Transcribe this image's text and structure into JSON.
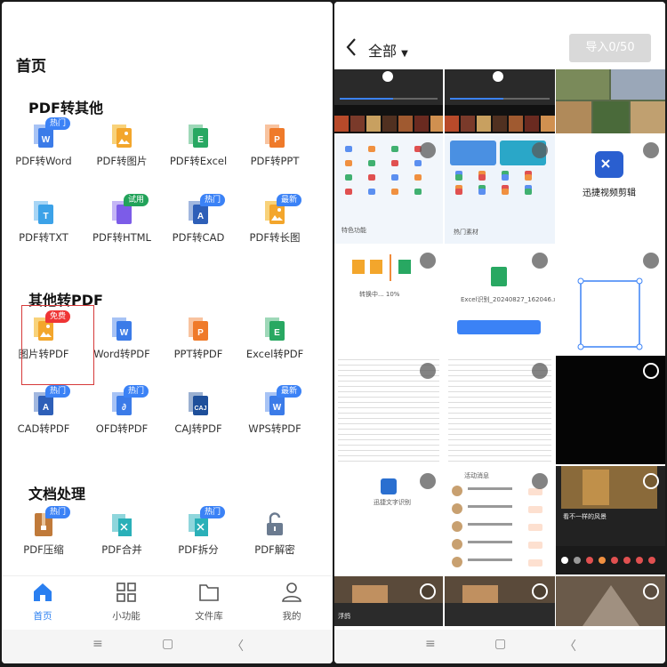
{
  "left": {
    "title": "首页",
    "sections": [
      {
        "title": "PDF转其他",
        "items": [
          {
            "label": "PDF转Word",
            "badge": "热门",
            "badge_color": "blue",
            "icon": "word-doc-icon",
            "color": "#3b7be8"
          },
          {
            "label": "PDF转图片",
            "badge": "",
            "icon": "image-doc-icon",
            "color": "#f3a62c"
          },
          {
            "label": "PDF转Excel",
            "badge": "",
            "icon": "excel-doc-icon",
            "color": "#28a862"
          },
          {
            "label": "PDF转PPT",
            "badge": "",
            "icon": "ppt-doc-icon",
            "color": "#ef7a2a"
          },
          {
            "label": "PDF转TXT",
            "badge": "",
            "icon": "txt-doc-icon",
            "color": "#3ca2e8"
          },
          {
            "label": "PDF转HTML",
            "badge": "试用",
            "badge_color": "green",
            "icon": "html-doc-icon",
            "color": "#7c5ce8"
          },
          {
            "label": "PDF转CAD",
            "badge": "热门",
            "badge_color": "blue",
            "icon": "cad-doc-icon",
            "color": "#2e5fb8"
          },
          {
            "label": "PDF转长图",
            "badge": "最新",
            "badge_color": "blue",
            "icon": "long-image-icon",
            "color": "#f3a62c"
          }
        ]
      },
      {
        "title": "其他转PDF",
        "items": [
          {
            "label": "图片转PDF",
            "badge": "免费",
            "badge_color": "red",
            "icon": "image-to-pdf-icon",
            "color": "#f3a62c",
            "selected": true
          },
          {
            "label": "Word转PDF",
            "badge": "",
            "icon": "word-to-pdf-icon",
            "color": "#3b7be8"
          },
          {
            "label": "PPT转PDF",
            "badge": "",
            "icon": "ppt-to-pdf-icon",
            "color": "#ef7a2a"
          },
          {
            "label": "Excel转PDF",
            "badge": "",
            "icon": "excel-to-pdf-icon",
            "color": "#28a862"
          },
          {
            "label": "CAD转PDF",
            "badge": "热门",
            "badge_color": "blue",
            "icon": "cad-to-pdf-icon",
            "color": "#2e5fb8"
          },
          {
            "label": "OFD转PDF",
            "badge": "热门",
            "badge_color": "blue",
            "icon": "ofd-to-pdf-icon",
            "color": "#3b7be8"
          },
          {
            "label": "CAJ转PDF",
            "badge": "",
            "icon": "caj-to-pdf-icon",
            "color": "#1e4f9a"
          },
          {
            "label": "WPS转PDF",
            "badge": "最新",
            "badge_color": "blue",
            "icon": "wps-to-pdf-icon",
            "color": "#3b7be8"
          }
        ]
      },
      {
        "title": "文档处理",
        "items": [
          {
            "label": "PDF压缩",
            "badge": "热门",
            "badge_color": "blue",
            "icon": "zip-icon",
            "color": "#c07a3a"
          },
          {
            "label": "PDF合并",
            "badge": "",
            "icon": "merge-icon",
            "color": "#2ab0b8"
          },
          {
            "label": "PDF拆分",
            "badge": "热门",
            "badge_color": "blue",
            "icon": "split-icon",
            "color": "#2ab0b8"
          },
          {
            "label": "PDF解密",
            "badge": "",
            "icon": "unlock-icon",
            "color": "#6b7b90"
          }
        ]
      }
    ],
    "nav": [
      {
        "label": "首页",
        "icon": "home-icon",
        "active": true
      },
      {
        "label": "小功能",
        "icon": "grid-icon",
        "active": false
      },
      {
        "label": "文件库",
        "icon": "folder-icon",
        "active": false
      },
      {
        "label": "我的",
        "icon": "user-icon",
        "active": false
      }
    ],
    "sysbar": {
      "menu": "≡",
      "home": "▢",
      "back": "〈"
    }
  },
  "right": {
    "filter_label": "全部",
    "import_button": "导入0/50",
    "cells": [
      {
        "kind": "video",
        "selectable": false
      },
      {
        "kind": "video",
        "selectable": false
      },
      {
        "kind": "photo-collage",
        "selectable": false
      },
      {
        "kind": "app-screen",
        "selected": false,
        "text": "特色功能"
      },
      {
        "kind": "app-screen-blue",
        "selected": false,
        "text": "热门素材"
      },
      {
        "kind": "logo",
        "selected": false,
        "text": "迅捷视频剪辑"
      },
      {
        "kind": "loading",
        "selected": false,
        "text": "转换中... 10%"
      },
      {
        "kind": "excel",
        "selected": false,
        "text": "Excel识别_20240827_162046.xls"
      },
      {
        "kind": "crop-frame",
        "selected": false
      },
      {
        "kind": "table",
        "selected": false
      },
      {
        "kind": "table",
        "selected": false
      },
      {
        "kind": "dark",
        "selected": false
      },
      {
        "kind": "ocr",
        "selected": false,
        "text": "迅捷文字识别"
      },
      {
        "kind": "chat",
        "selected": false,
        "text": "活动消息"
      },
      {
        "kind": "editor",
        "selected": false,
        "text": "看不一样的风景"
      },
      {
        "kind": "photo-dark",
        "selected": false,
        "text": "浮鸽"
      },
      {
        "kind": "photo-dark",
        "selected": false
      },
      {
        "kind": "photo-street",
        "selected": false
      }
    ],
    "sysbar": {
      "menu": "≡",
      "home": "▢",
      "back": "〈"
    }
  }
}
